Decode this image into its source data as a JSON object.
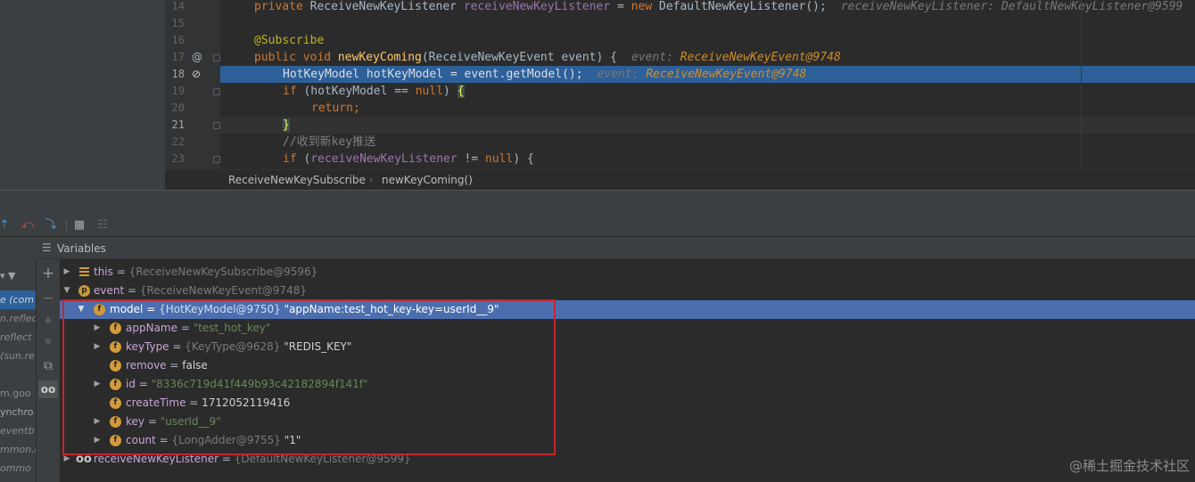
{
  "editor": {
    "lines": [
      {
        "num": "14",
        "gutter": "",
        "fold": false
      },
      {
        "num": "15",
        "gutter": "",
        "fold": false
      },
      {
        "num": "16",
        "gutter": "",
        "fold": false
      },
      {
        "num": "17",
        "gutter": "@",
        "fold": true
      },
      {
        "num": "18",
        "gutter": "⊘",
        "fold": false
      },
      {
        "num": "19",
        "gutter": "",
        "fold": true
      },
      {
        "num": "20",
        "gutter": "",
        "fold": false
      },
      {
        "num": "21",
        "gutter": "",
        "fold": true
      },
      {
        "num": "22",
        "gutter": "",
        "fold": false
      },
      {
        "num": "23",
        "gutter": "",
        "fold": true
      }
    ],
    "code": {
      "l14": {
        "kw": "private",
        "type": "ReceiveNewKeyListener",
        "field": "receiveNewKeyListener",
        "eq": " = ",
        "new": "new",
        "rest": " DefaultNewKeyListener();",
        "hint": "receiveNewKeyListener: DefaultNewKeyListener@9599"
      },
      "l16": {
        "ann": "@Subscribe"
      },
      "l17": {
        "kw": "public void",
        "fn": "newKeyComing",
        "rest": "(ReceiveNewKeyEvent event) {",
        "hint_label": "event: ",
        "hint_type": "ReceiveNewKeyEvent@9748"
      },
      "l18": {
        "text": "HotKeyModel hotKeyModel = event.getModel();",
        "hint_label": "event: ",
        "hint_type": "ReceiveNewKeyEvent@9748"
      },
      "l19": {
        "kw": "if",
        "rest": " (hotKeyModel == ",
        "null": "null",
        "tail": ") ",
        "brace": "{"
      },
      "l20": {
        "kw": "return",
        "rest": ";"
      },
      "l21": {
        "brace": "}"
      },
      "l22": {
        "comment": "//收到新key推送"
      },
      "l23": {
        "kw": "if",
        "rest": " (",
        "field": "receiveNewKeyListener",
        "mid": " != ",
        "null": "null",
        "tail": ") {"
      }
    },
    "breadcrumb": [
      "ReceiveNewKeySubscribe",
      "newKeyComing()"
    ]
  },
  "variables_panel": {
    "title": "Variables"
  },
  "frames": [
    "",
    "e (com",
    "n.reflec",
    "reflect",
    "(sun.re",
    "",
    "m.goo",
    "ynchro",
    "eventb",
    "mmon.u",
    "ommo"
  ],
  "variables": [
    {
      "name": "this",
      "ref": "{ReceiveNewKeySubscribe@9596}",
      "value": "",
      "icon": "lines"
    },
    {
      "name": "event",
      "ref": "{ReceiveNewKeyEvent@9748}",
      "value": "",
      "icon": "p"
    },
    {
      "name": "model",
      "ref": "{HotKeyModel@9750}",
      "value": "\"appName:test_hot_key-key=userId__9\"",
      "icon": "f"
    },
    {
      "name": "appName",
      "ref": "",
      "value": "\"test_hot_key\"",
      "icon": "f"
    },
    {
      "name": "keyType",
      "ref": "{KeyType@9628}",
      "value": "\"REDIS_KEY\"",
      "icon": "f"
    },
    {
      "name": "remove",
      "ref": "",
      "value": "false",
      "icon": "f"
    },
    {
      "name": "id",
      "ref": "",
      "value": "\"8336c719d41f449b93c42182894f141f\"",
      "icon": "f"
    },
    {
      "name": "createTime",
      "ref": "",
      "value": "1712052119416",
      "icon": "f"
    },
    {
      "name": "key",
      "ref": "",
      "value": "\"userId__9\"",
      "icon": "f"
    },
    {
      "name": "count",
      "ref": "{LongAdder@9755}",
      "value": "\"1\"",
      "icon": "f"
    },
    {
      "name": "receiveNewKeyListener",
      "ref": "{DefaultNewKeyListener@9599}",
      "value": "",
      "icon": "oo"
    }
  ],
  "watermark": "@稀土掘金技术社区",
  "colors": {
    "selection": "#4b6eaf",
    "highlight_line": "#2d6099",
    "red_box": "#c8242c"
  }
}
